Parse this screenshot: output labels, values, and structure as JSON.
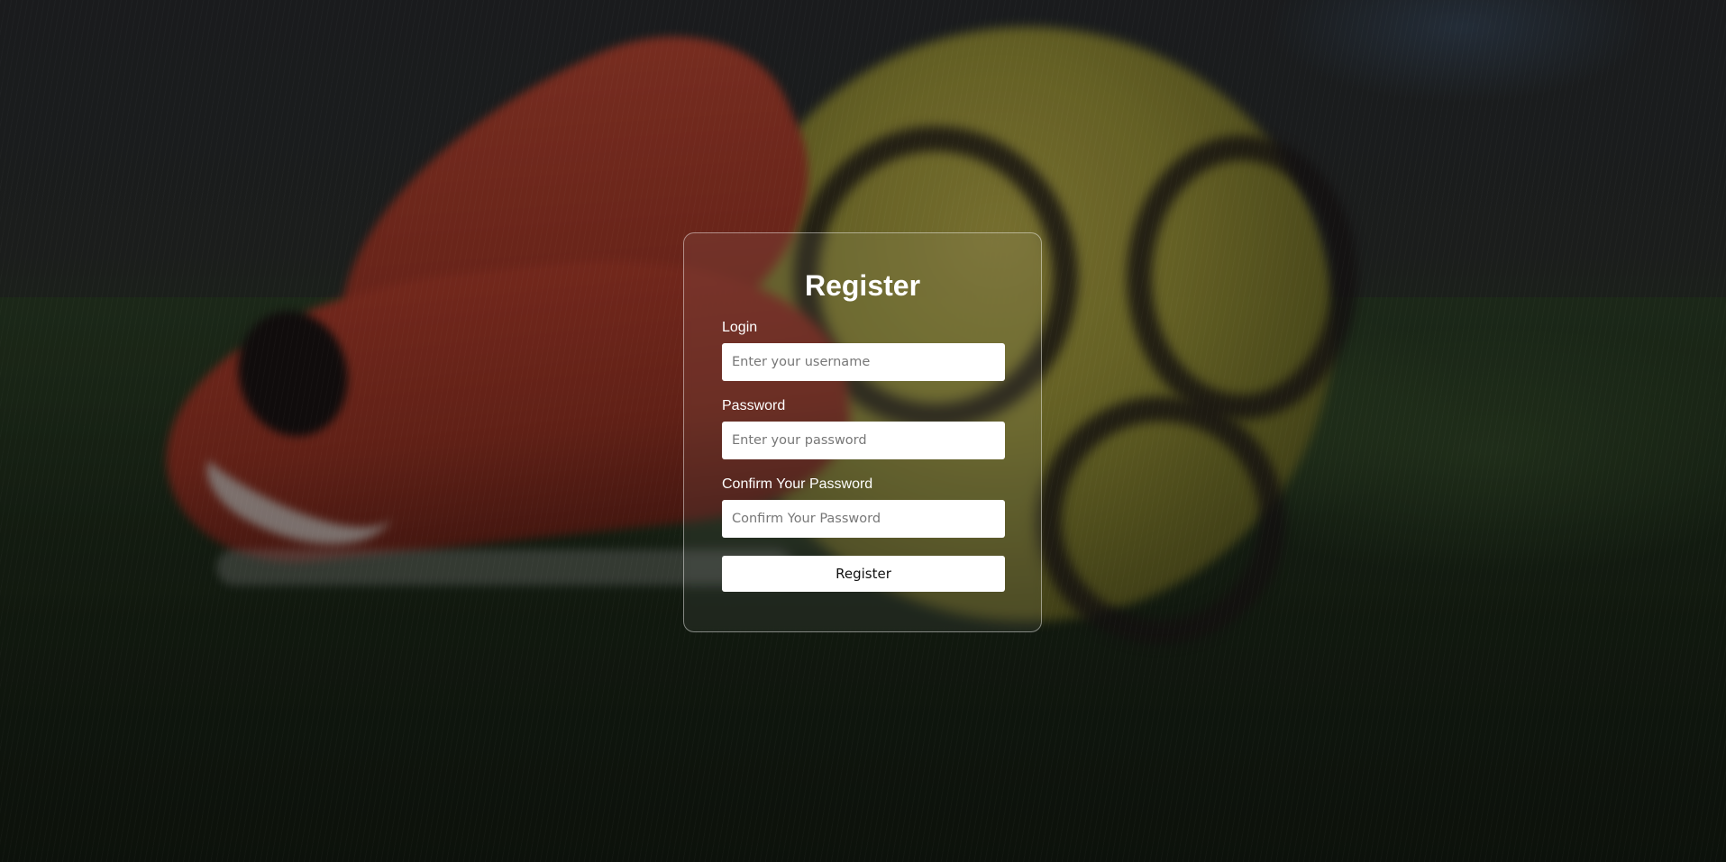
{
  "form": {
    "title": "Register",
    "fields": [
      {
        "label": "Login",
        "placeholder": "Enter your username",
        "value": ""
      },
      {
        "label": "Password",
        "placeholder": "Enter your password",
        "value": ""
      },
      {
        "label": "Confirm Your Password",
        "placeholder": "Confirm Your Password",
        "value": ""
      }
    ],
    "submit_label": "Register"
  },
  "colors": {
    "card_border": "#ffffff",
    "text": "#ffffff",
    "input_bg": "#ffffff",
    "button_bg": "#ffffff",
    "button_text": "#111111"
  }
}
